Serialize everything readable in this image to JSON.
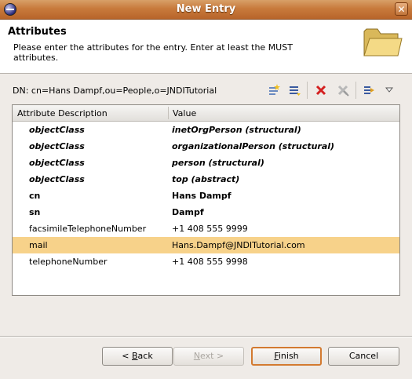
{
  "window": {
    "title": "New Entry"
  },
  "header": {
    "title": "Attributes",
    "description": "Please enter the attributes for the entry. Enter at least the MUST attributes."
  },
  "dn": {
    "label": "DN: cn=Hans Dampf,ou=People,o=JNDITutorial"
  },
  "toolbar": {
    "icons": [
      "new-attribute-icon",
      "new-value-icon",
      "delete-icon",
      "delete-all-icon",
      "apply-icon",
      "menu-dropdown-icon"
    ]
  },
  "table": {
    "columns": [
      "Attribute Description",
      "Value"
    ],
    "rows": [
      {
        "attribute": "objectClass",
        "value": "inetOrgPerson (structural)"
      },
      {
        "attribute": "objectClass",
        "value": "organizationalPerson (structural)"
      },
      {
        "attribute": "objectClass",
        "value": "person (structural)"
      },
      {
        "attribute": "objectClass",
        "value": "top (abstract)"
      },
      {
        "attribute": "cn",
        "value": "Hans Dampf"
      },
      {
        "attribute": "sn",
        "value": "Dampf"
      },
      {
        "attribute": "facsimileTelephoneNumber",
        "value": "+1 408 555 9999"
      },
      {
        "attribute": "mail",
        "value": "Hans.Dampf@JNDITutorial.com"
      },
      {
        "attribute": "telephoneNumber",
        "value": "+1 408 555 9998"
      }
    ]
  },
  "buttons": {
    "back": {
      "mnemonic": "B",
      "pre": "< ",
      "rest": "ack"
    },
    "next": {
      "mnemonic": "N",
      "rest": "ext >"
    },
    "finish": {
      "mnemonic": "F",
      "rest": "inish"
    },
    "cancel": "Cancel"
  },
  "colors": {
    "titlebar": "#c87a3c",
    "selection": "#f7d28a",
    "default_button_border": "#d37a30"
  }
}
